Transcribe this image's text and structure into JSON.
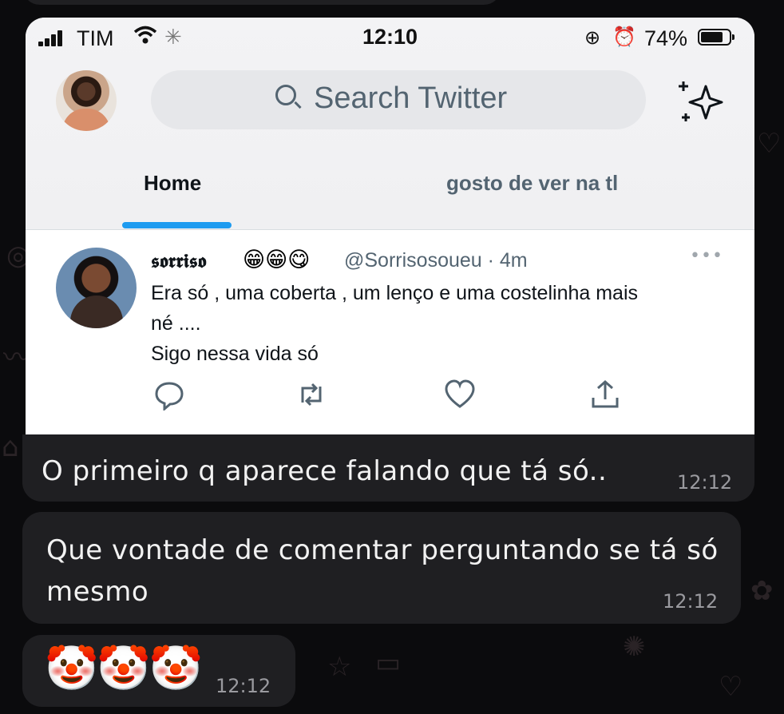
{
  "status_bar": {
    "carrier": "TIM",
    "time": "12:10",
    "battery": "74%"
  },
  "twitter": {
    "search_placeholder": "Search Twitter",
    "tabs": [
      {
        "label": "Home",
        "active": true
      },
      {
        "label": "gosto de ver na tl",
        "active": false
      }
    ],
    "accent_color": "#1d9bf0",
    "tweet": {
      "display_name": "𝖘𝖔𝖗𝖗𝖎𝖘𝖔",
      "name_emojis": "😁😁😋",
      "handle_time": "@Sorrisosoueu · 4m",
      "more": "•••",
      "text": "Era só , uma coberta , um lenço e uma costelinha mais\nné ....\nSigo nessa vida só",
      "actions": [
        "reply-icon",
        "retweet-icon",
        "like-icon",
        "share-icon"
      ]
    }
  },
  "chat": {
    "messages": [
      {
        "text": "O primeiro q aparece falando que tá só..",
        "time": "12:12"
      },
      {
        "text": "Que vontade de comentar perguntando se tá só mesmo",
        "time": "12:12"
      },
      {
        "text": "🤡🤡🤡",
        "time": "12:12"
      }
    ]
  }
}
